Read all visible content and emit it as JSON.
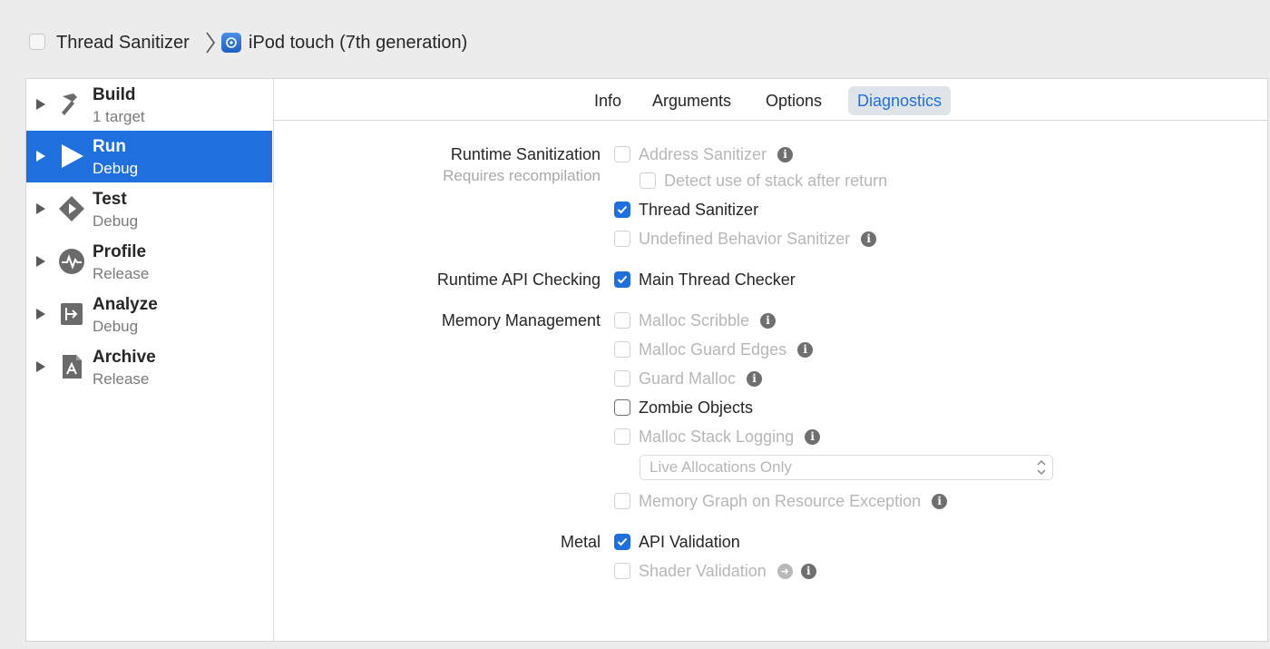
{
  "breadcrumb": {
    "scheme": "Thread Sanitizer",
    "device": "iPod touch (7th generation)"
  },
  "sidebar": {
    "items": [
      {
        "title": "Build",
        "subtitle": "1 target",
        "icon": "hammer-icon",
        "selected": false
      },
      {
        "title": "Run",
        "subtitle": "Debug",
        "icon": "play-icon",
        "selected": true
      },
      {
        "title": "Test",
        "subtitle": "Debug",
        "icon": "diamond-play-icon",
        "selected": false
      },
      {
        "title": "Profile",
        "subtitle": "Release",
        "icon": "waveform-icon",
        "selected": false
      },
      {
        "title": "Analyze",
        "subtitle": "Debug",
        "icon": "analyze-icon",
        "selected": false
      },
      {
        "title": "Archive",
        "subtitle": "Release",
        "icon": "archive-icon",
        "selected": false
      }
    ]
  },
  "tabs": [
    {
      "label": "Info",
      "active": false
    },
    {
      "label": "Arguments",
      "active": false
    },
    {
      "label": "Options",
      "active": false
    },
    {
      "label": "Diagnostics",
      "active": true
    }
  ],
  "diagnostics": {
    "runtime_sanitization": {
      "label": "Runtime Sanitization",
      "note": "Requires recompilation",
      "address_sanitizer": {
        "label": "Address Sanitizer",
        "checked": false,
        "enabled": false
      },
      "detect_stack_after_return": {
        "label": "Detect use of stack after return",
        "checked": false,
        "enabled": false
      },
      "thread_sanitizer": {
        "label": "Thread Sanitizer",
        "checked": true,
        "enabled": true
      },
      "undefined_behavior_sanitizer": {
        "label": "Undefined Behavior Sanitizer",
        "checked": false,
        "enabled": false
      }
    },
    "runtime_api_checking": {
      "label": "Runtime API Checking",
      "main_thread_checker": {
        "label": "Main Thread Checker",
        "checked": true,
        "enabled": true
      }
    },
    "memory_management": {
      "label": "Memory Management",
      "malloc_scribble": {
        "label": "Malloc Scribble",
        "checked": false,
        "enabled": false
      },
      "malloc_guard_edges": {
        "label": "Malloc Guard Edges",
        "checked": false,
        "enabled": false
      },
      "guard_malloc": {
        "label": "Guard Malloc",
        "checked": false,
        "enabled": false
      },
      "zombie_objects": {
        "label": "Zombie Objects",
        "checked": false,
        "enabled": true
      },
      "malloc_stack_logging": {
        "label": "Malloc Stack Logging",
        "checked": false,
        "enabled": false
      },
      "malloc_stack_logging_mode": "Live Allocations Only",
      "memory_graph": {
        "label": "Memory Graph on Resource Exception",
        "checked": false,
        "enabled": false
      }
    },
    "metal": {
      "label": "Metal",
      "api_validation": {
        "label": "API Validation",
        "checked": true,
        "enabled": true
      },
      "shader_validation": {
        "label": "Shader Validation",
        "checked": false,
        "enabled": false
      }
    }
  },
  "colors": {
    "accent": "#1f6fde",
    "disabled_text": "#b7b7b7",
    "sidebar_selected": "#1f6fde"
  }
}
